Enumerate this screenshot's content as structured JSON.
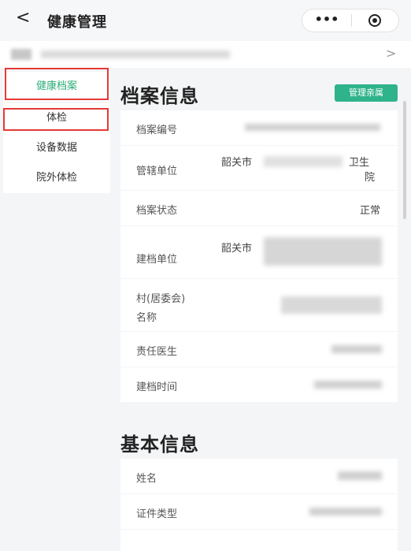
{
  "header": {
    "back_glyph": "<",
    "title": "健康管理",
    "more_glyph": "•••"
  },
  "userbar": {
    "chevron": ">"
  },
  "sidebar": {
    "items": [
      {
        "label": "健康档案",
        "active": true
      },
      {
        "label": "体检",
        "active": false
      },
      {
        "label": "设备数据",
        "active": false
      },
      {
        "label": "院外体检",
        "active": false
      }
    ]
  },
  "main": {
    "record_section": {
      "title": "档案信息",
      "manage_button": "管理亲属",
      "fields": {
        "record_no": {
          "label": "档案编号"
        },
        "jurisdiction": {
          "label": "管辖单位",
          "value_prefix": "韶关市",
          "value_tail_1": "卫生",
          "value_tail_2": "院"
        },
        "status": {
          "label": "档案状态",
          "value": "正常"
        },
        "builder": {
          "label": "建档单位",
          "value_prefix": "韶关市"
        },
        "village": {
          "label_line1": "村(居委会)",
          "label_line2": "名称"
        },
        "doctor": {
          "label": "责任医生"
        },
        "created": {
          "label": "建档时间"
        }
      }
    },
    "basic_section": {
      "title": "基本信息",
      "fields": {
        "name": {
          "label": "姓名"
        },
        "id_type": {
          "label": "证件类型"
        }
      }
    }
  },
  "colors": {
    "accent": "#2fb38a",
    "active_text": "#2fae7a",
    "highlight": "#e53935"
  },
  "icons": {
    "back": "chevron-left-icon",
    "more": "more-dots-icon",
    "capsule_close": "target-circle-icon",
    "userbar_chevron": "chevron-right-icon"
  }
}
